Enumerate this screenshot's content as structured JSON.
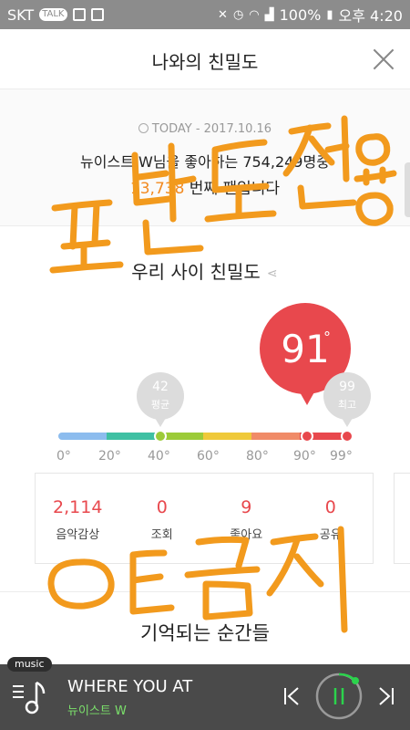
{
  "status_bar": {
    "carrier": "SKT",
    "talk_badge": "TALK",
    "battery": "100%",
    "time": "오후 4:20"
  },
  "header": {
    "title": "나와의 친밀도"
  },
  "today": {
    "date": "TODAY - 2017.10.16",
    "line1": "뉴이스트 W님을 좋아하는 754,249명중",
    "rank": "13,738",
    "rank_suffix": " 번째 팬입니다"
  },
  "intimacy": {
    "title": "우리 사이 친밀도",
    "score": "91",
    "score_degree": "°",
    "average_value": "42",
    "average_label": "평균",
    "max_value": "99",
    "max_label": "최고",
    "ticks": [
      "0°",
      "20°",
      "40°",
      "60°",
      "80°",
      "90°",
      "99°"
    ]
  },
  "stats": [
    {
      "value": "2,114",
      "label": "음악감상"
    },
    {
      "value": "0",
      "label": "조회"
    },
    {
      "value": "9",
      "label": "좋아요"
    },
    {
      "value": "0",
      "label": "공유"
    }
  ],
  "memories": {
    "title": "기억되는 순간들"
  },
  "player": {
    "tag": "music",
    "track": "WHERE YOU AT",
    "artist": "뉴이스트 W"
  },
  "colors": {
    "accent_red": "#e8484d",
    "accent_orange": "#f28a20",
    "artist_green": "#7be06b",
    "handwriting": "#f29a1d"
  }
}
